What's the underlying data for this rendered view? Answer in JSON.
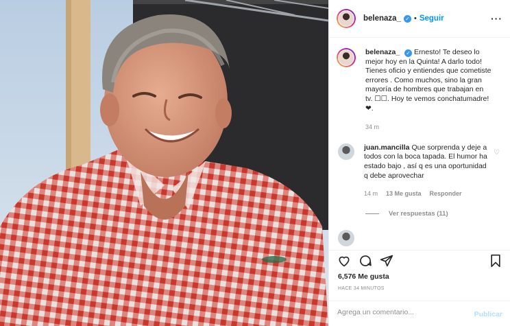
{
  "header": {
    "username": "belenaza_",
    "separator": "•",
    "follow_label": "Seguir",
    "more_label": "···"
  },
  "caption": {
    "username": "belenaza_",
    "text": "Ernesto! Te deseo lo mejor hoy en la Quinta! A darlo todo! Tienes oficio y entiendes que cometiste errores . Como muchos, sino la gran mayoría de hombres que trabajan en tv. ☐☐. Hoy te vemos conchatumadre! ❤.",
    "time": "34 m"
  },
  "comment": {
    "username": "juan.mancilla",
    "text": "Que sorprenda y deje a todos con la boca tapada. El humor ha estado bajo , así q es una oportunidad q debe aprovechar",
    "time": "14 m",
    "likes": "13 Me gusta",
    "reply_label": "Responder"
  },
  "view_replies": "Ver respuestas (11)",
  "likes_count": "6,576 Me gusta",
  "posted_time": "HACE 34 MINUTOS",
  "add_comment": {
    "placeholder": "Agrega un comentario..."
  },
  "publish_label": "Publicar",
  "colors": {
    "link": "#0095f6",
    "publish_disabled": "#b2dffc",
    "muted": "#8e8e8e",
    "shirt_red": "#e0473a"
  }
}
